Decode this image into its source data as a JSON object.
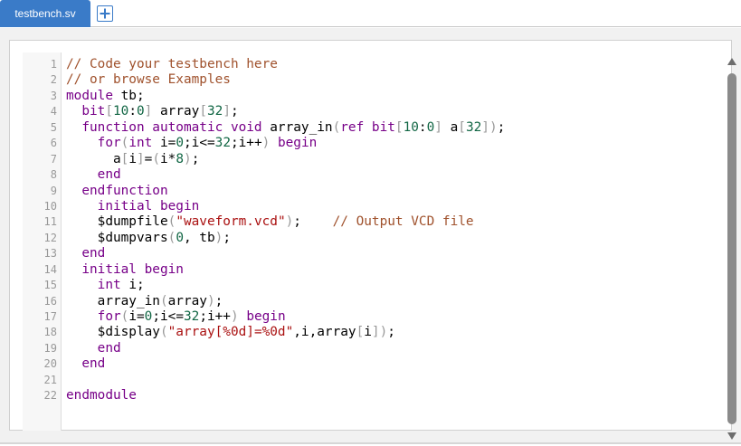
{
  "tabs": [
    {
      "label": "testbench.sv",
      "active": true
    }
  ],
  "colors": {
    "tab_active": "#3a7bc8",
    "comment": "#a0522d",
    "keyword": "#770088",
    "number": "#116644",
    "string": "#aa1111",
    "bracket": "#999999"
  },
  "editor": {
    "lines": [
      {
        "n": "1",
        "tokens": [
          {
            "t": "// Code your testbench here",
            "c": "cm"
          }
        ]
      },
      {
        "n": "2",
        "tokens": [
          {
            "t": "// or browse Examples",
            "c": "cm"
          }
        ]
      },
      {
        "n": "3",
        "tokens": [
          {
            "t": "module",
            "c": "kw"
          },
          {
            "t": " tb;",
            "c": "pn"
          }
        ]
      },
      {
        "n": "4",
        "tokens": [
          {
            "t": "  ",
            "c": "pn"
          },
          {
            "t": "bit",
            "c": "kw"
          },
          {
            "t": "[",
            "c": "br"
          },
          {
            "t": "10",
            "c": "nm"
          },
          {
            "t": ":",
            "c": "pn"
          },
          {
            "t": "0",
            "c": "nm"
          },
          {
            "t": "]",
            "c": "br"
          },
          {
            "t": " array",
            "c": "pn"
          },
          {
            "t": "[",
            "c": "br"
          },
          {
            "t": "32",
            "c": "nm"
          },
          {
            "t": "]",
            "c": "br"
          },
          {
            "t": ";",
            "c": "pn"
          }
        ]
      },
      {
        "n": "5",
        "tokens": [
          {
            "t": "  ",
            "c": "pn"
          },
          {
            "t": "function automatic void",
            "c": "kw"
          },
          {
            "t": " array_in",
            "c": "pn"
          },
          {
            "t": "(",
            "c": "br"
          },
          {
            "t": "ref bit",
            "c": "kw"
          },
          {
            "t": "[",
            "c": "br"
          },
          {
            "t": "10",
            "c": "nm"
          },
          {
            "t": ":",
            "c": "pn"
          },
          {
            "t": "0",
            "c": "nm"
          },
          {
            "t": "]",
            "c": "br"
          },
          {
            "t": " a",
            "c": "pn"
          },
          {
            "t": "[",
            "c": "br"
          },
          {
            "t": "32",
            "c": "nm"
          },
          {
            "t": "]",
            "c": "br"
          },
          {
            "t": ")",
            "c": "br"
          },
          {
            "t": ";",
            "c": "pn"
          }
        ]
      },
      {
        "n": "6",
        "tokens": [
          {
            "t": "    ",
            "c": "pn"
          },
          {
            "t": "for",
            "c": "kw"
          },
          {
            "t": "(",
            "c": "br"
          },
          {
            "t": "int",
            "c": "kw"
          },
          {
            "t": " i=",
            "c": "pn"
          },
          {
            "t": "0",
            "c": "nm"
          },
          {
            "t": ";i<=",
            "c": "pn"
          },
          {
            "t": "32",
            "c": "nm"
          },
          {
            "t": ";i++",
            "c": "pn"
          },
          {
            "t": ")",
            "c": "br"
          },
          {
            "t": " ",
            "c": "pn"
          },
          {
            "t": "begin",
            "c": "kw"
          }
        ]
      },
      {
        "n": "7",
        "tokens": [
          {
            "t": "      a",
            "c": "pn"
          },
          {
            "t": "[",
            "c": "br"
          },
          {
            "t": "i",
            "c": "pn"
          },
          {
            "t": "]",
            "c": "br"
          },
          {
            "t": "=",
            "c": "pn"
          },
          {
            "t": "(",
            "c": "br"
          },
          {
            "t": "i*",
            "c": "pn"
          },
          {
            "t": "8",
            "c": "nm"
          },
          {
            "t": ")",
            "c": "br"
          },
          {
            "t": ";",
            "c": "pn"
          }
        ]
      },
      {
        "n": "8",
        "tokens": [
          {
            "t": "    ",
            "c": "pn"
          },
          {
            "t": "end",
            "c": "kw"
          }
        ]
      },
      {
        "n": "9",
        "tokens": [
          {
            "t": "  ",
            "c": "pn"
          },
          {
            "t": "endfunction",
            "c": "kw"
          }
        ]
      },
      {
        "n": "10",
        "tokens": [
          {
            "t": "    ",
            "c": "pn"
          },
          {
            "t": "initial begin",
            "c": "kw"
          }
        ]
      },
      {
        "n": "11",
        "tokens": [
          {
            "t": "    $dumpfile",
            "c": "pn"
          },
          {
            "t": "(",
            "c": "br"
          },
          {
            "t": "\"waveform.vcd\"",
            "c": "st"
          },
          {
            "t": ")",
            "c": "br"
          },
          {
            "t": ";    ",
            "c": "pn"
          },
          {
            "t": "// Output VCD file",
            "c": "cm"
          }
        ]
      },
      {
        "n": "12",
        "tokens": [
          {
            "t": "    $dumpvars",
            "c": "pn"
          },
          {
            "t": "(",
            "c": "br"
          },
          {
            "t": "0",
            "c": "nm"
          },
          {
            "t": ", tb",
            "c": "pn"
          },
          {
            "t": ")",
            "c": "br"
          },
          {
            "t": ";",
            "c": "pn"
          }
        ]
      },
      {
        "n": "13",
        "tokens": [
          {
            "t": "  ",
            "c": "pn"
          },
          {
            "t": "end",
            "c": "kw"
          }
        ]
      },
      {
        "n": "14",
        "tokens": [
          {
            "t": "  ",
            "c": "pn"
          },
          {
            "t": "initial begin",
            "c": "kw"
          }
        ]
      },
      {
        "n": "15",
        "tokens": [
          {
            "t": "    ",
            "c": "pn"
          },
          {
            "t": "int",
            "c": "kw"
          },
          {
            "t": " i;",
            "c": "pn"
          }
        ]
      },
      {
        "n": "16",
        "tokens": [
          {
            "t": "    array_in",
            "c": "pn"
          },
          {
            "t": "(",
            "c": "br"
          },
          {
            "t": "array",
            "c": "pn"
          },
          {
            "t": ")",
            "c": "br"
          },
          {
            "t": ";",
            "c": "pn"
          }
        ]
      },
      {
        "n": "17",
        "tokens": [
          {
            "t": "    ",
            "c": "pn"
          },
          {
            "t": "for",
            "c": "kw"
          },
          {
            "t": "(",
            "c": "br"
          },
          {
            "t": "i=",
            "c": "pn"
          },
          {
            "t": "0",
            "c": "nm"
          },
          {
            "t": ";i<=",
            "c": "pn"
          },
          {
            "t": "32",
            "c": "nm"
          },
          {
            "t": ";i++",
            "c": "pn"
          },
          {
            "t": ")",
            "c": "br"
          },
          {
            "t": " ",
            "c": "pn"
          },
          {
            "t": "begin",
            "c": "kw"
          }
        ]
      },
      {
        "n": "18",
        "tokens": [
          {
            "t": "    $display",
            "c": "pn"
          },
          {
            "t": "(",
            "c": "br"
          },
          {
            "t": "\"array[%0d]=%0d\"",
            "c": "st"
          },
          {
            "t": ",i,array",
            "c": "pn"
          },
          {
            "t": "[",
            "c": "br"
          },
          {
            "t": "i",
            "c": "pn"
          },
          {
            "t": "]",
            "c": "br"
          },
          {
            "t": ")",
            "c": "br"
          },
          {
            "t": ";",
            "c": "pn"
          }
        ]
      },
      {
        "n": "19",
        "tokens": [
          {
            "t": "    ",
            "c": "pn"
          },
          {
            "t": "end",
            "c": "kw"
          }
        ]
      },
      {
        "n": "20",
        "tokens": [
          {
            "t": "  ",
            "c": "pn"
          },
          {
            "t": "end",
            "c": "kw"
          }
        ]
      },
      {
        "n": "21",
        "tokens": []
      },
      {
        "n": "22",
        "tokens": [
          {
            "t": "endmodule",
            "c": "kw"
          }
        ]
      }
    ]
  }
}
